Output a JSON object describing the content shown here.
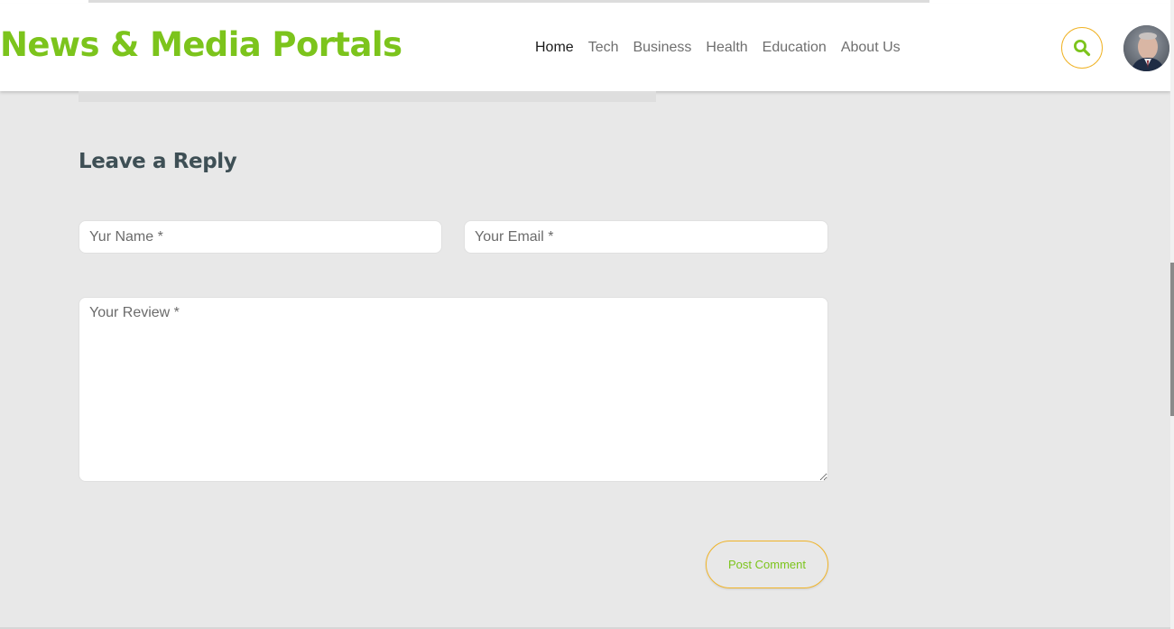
{
  "header": {
    "logo_text": "News & Media Portals",
    "nav": [
      {
        "label": "Home",
        "active": true
      },
      {
        "label": "Tech",
        "active": false
      },
      {
        "label": "Business",
        "active": false
      },
      {
        "label": "Health",
        "active": false
      },
      {
        "label": "Education",
        "active": false
      },
      {
        "label": "About Us",
        "active": false
      }
    ],
    "search_icon": "search-icon",
    "avatar": "user-avatar"
  },
  "reply": {
    "title": "Leave a Reply",
    "name_placeholder": "Yur Name *",
    "email_placeholder": "Your Email *",
    "review_placeholder": "Your Review *",
    "submit_label": "Post Comment"
  },
  "colors": {
    "brand_green": "#7cc41c",
    "accent_orange": "#f0b429",
    "page_bg": "#e8e8e8",
    "heading": "#3e4f55"
  }
}
